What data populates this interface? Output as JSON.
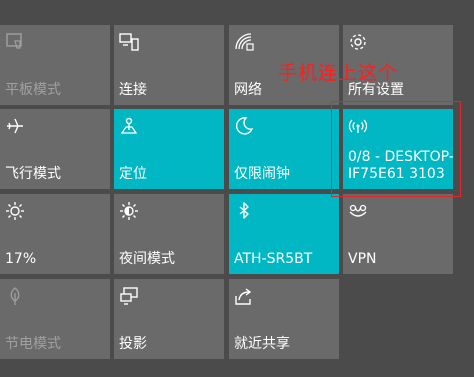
{
  "tiles": [
    {
      "label": "平板模式",
      "icon": "tablet-mode-icon",
      "state": "disabled"
    },
    {
      "label": "连接",
      "icon": "connect-icon",
      "state": "off"
    },
    {
      "label": "网络",
      "icon": "network-icon",
      "state": "off"
    },
    {
      "label": "所有设置",
      "icon": "settings-gear-icon",
      "state": "off"
    },
    {
      "label": "飞行模式",
      "icon": "airplane-icon",
      "state": "off"
    },
    {
      "label": "定位",
      "icon": "location-icon",
      "state": "on"
    },
    {
      "label": "仅限闹钟",
      "icon": "moon-icon",
      "state": "on"
    },
    {
      "label": "0/8 - DESKTOP-IF75E61 3103",
      "icon": "mobile-hotspot-icon",
      "state": "on"
    },
    {
      "label": "17%",
      "icon": "brightness-icon",
      "state": "off"
    },
    {
      "label": "夜间模式",
      "icon": "night-light-icon",
      "state": "off"
    },
    {
      "label": "ATH-SR5BT",
      "icon": "bluetooth-icon",
      "state": "on"
    },
    {
      "label": "VPN",
      "icon": "vpn-icon",
      "state": "off"
    },
    {
      "label": "节电模式",
      "icon": "battery-saver-icon",
      "state": "disabled"
    },
    {
      "label": "投影",
      "icon": "project-icon",
      "state": "off"
    },
    {
      "label": "就近共享",
      "icon": "nearby-sharing-icon",
      "state": "off"
    }
  ],
  "annotation": {
    "text": "手机连上这个",
    "color": "#ff1e1e"
  },
  "colors": {
    "background": "#4b4b4b",
    "tile_off": "#6a6a6a",
    "tile_on": "#00b7c3",
    "text": "#ffffff",
    "text_disabled": "#a0a0a0"
  }
}
